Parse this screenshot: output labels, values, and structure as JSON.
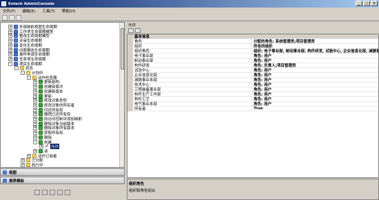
{
  "window": {
    "title": "Extech AdminConsole"
  },
  "menu": [
    "文件(F)",
    "编辑(E)",
    "工具(T)",
    "帮助(H)"
  ],
  "tree": [
    {
      "label": "外部映射视图生命周期",
      "depth": 1,
      "exp": "+",
      "icon": "blue"
    },
    {
      "label": "工作项生命周期模型",
      "depth": 1,
      "exp": "+",
      "icon": "blue"
    },
    {
      "label": "整改生命周期模型",
      "depth": 1,
      "exp": "+",
      "icon": "blue"
    },
    {
      "label": "评审生命周期",
      "depth": 1,
      "exp": "+",
      "icon": "blue"
    },
    {
      "label": "变化生命周期",
      "depth": 1,
      "exp": "+",
      "icon": "blue"
    },
    {
      "label": "问题报告生命周期",
      "depth": 1,
      "exp": "+",
      "icon": "blue"
    },
    {
      "label": "事件申请生命周期",
      "depth": 1,
      "exp": "+",
      "icon": "blue"
    },
    {
      "label": "任务项生命周期",
      "depth": 1,
      "exp": "+",
      "icon": "blue"
    },
    {
      "label": "项目生命周期",
      "depth": 1,
      "exp": "-",
      "icon": "blue"
    },
    {
      "label": "状态",
      "depth": 2,
      "exp": "-",
      "icon": "folder"
    },
    {
      "label": "计划中",
      "depth": 3,
      "exp": "-",
      "icon": "folder"
    },
    {
      "label": "动作检查器",
      "depth": 4,
      "exp": "-",
      "icon": "folder"
    },
    {
      "label": "更新结构",
      "depth": 5,
      "exp": "+",
      "icon": "green"
    },
    {
      "label": "创建新版次",
      "depth": 5,
      "exp": "+",
      "icon": "green"
    },
    {
      "label": "创建新版本",
      "depth": 5,
      "exp": "+",
      "icon": "green"
    },
    {
      "label": "更新",
      "depth": 5,
      "exp": "+",
      "icon": "green"
    },
    {
      "label": "修改对象类型",
      "depth": 5,
      "exp": "+",
      "icon": "green"
    },
    {
      "label": "修改对象的所有者",
      "depth": 5,
      "exp": "+",
      "icon": "green"
    },
    {
      "label": "归还所有权",
      "depth": 5,
      "exp": "+",
      "icon": "green"
    },
    {
      "label": "撤销已还所有权",
      "depth": 5,
      "exp": "+",
      "icon": "green"
    },
    {
      "label": "向访问控制中添加映射",
      "depth": 5,
      "exp": "+",
      "icon": "green"
    },
    {
      "label": "删除对象当前版本",
      "depth": 5,
      "exp": "+",
      "icon": "green"
    },
    {
      "label": "删除对象所有版本",
      "depth": 5,
      "exp": "+",
      "icon": "green"
    },
    {
      "label": "获取所有权",
      "depth": 5,
      "exp": "+",
      "icon": "green"
    },
    {
      "label": "删除",
      "depth": 5,
      "exp": "+",
      "icon": "green"
    },
    {
      "label": "创建",
      "depth": 5,
      "exp": "-",
      "icon": "green"
    },
    {
      "label": "允许",
      "depth": 6,
      "exp": "+",
      "icon": "check",
      "selected": true
    },
    {
      "label": "读",
      "depth": 5,
      "exp": "+",
      "icon": "green"
    },
    {
      "label": "动作订阅者",
      "depth": 4,
      "exp": "+",
      "icon": "folder"
    },
    {
      "label": "已分配",
      "depth": 3,
      "exp": "+",
      "icon": "folder"
    },
    {
      "label": "执行中",
      "depth": 3,
      "exp": "+",
      "icon": "folder"
    }
  ],
  "accordion": {
    "view": "视图",
    "report": "报表模板"
  },
  "props": {
    "header": "允许",
    "rows": [
      {
        "type": "category",
        "name": "基本信息",
        "value": ""
      },
      {
        "name": "角色",
        "value": "分配的角色: 系统管理员;项目管理员"
      },
      {
        "name": "组织",
        "value": "所有的组织"
      },
      {
        "name": "组织角色",
        "value": "组织: 电子事业部, 制动事业部, 构件研发, 试验中心, 企业信息化部, 减振事业..."
      },
      {
        "name": "电子事业部",
        "value": "角色: 用户"
      },
      {
        "name": "制动事业部",
        "value": "角色: 用户"
      },
      {
        "name": "构件研发",
        "value": "角色: 负责人;项目管理员"
      },
      {
        "name": "试验中心",
        "value": "角色: 用户"
      },
      {
        "name": "企业信息化部",
        "value": "角色: 用户"
      },
      {
        "name": "减振事业本部",
        "value": "角色: 用户"
      },
      {
        "name": "技术中心",
        "value": "角色: 用户"
      },
      {
        "name": "工程装备事业部",
        "value": "角色: 用户"
      },
      {
        "name": "构件生产工作部",
        "value": "角色: 用户"
      },
      {
        "name": "构件工艺",
        "value": "角色: 用户"
      },
      {
        "name": "电气事业本部",
        "value": "角色: 用户"
      },
      {
        "name": "所有者",
        "value": "True"
      }
    ]
  },
  "description": {
    "title": "组织角色",
    "text": "组织和角色组合"
  }
}
